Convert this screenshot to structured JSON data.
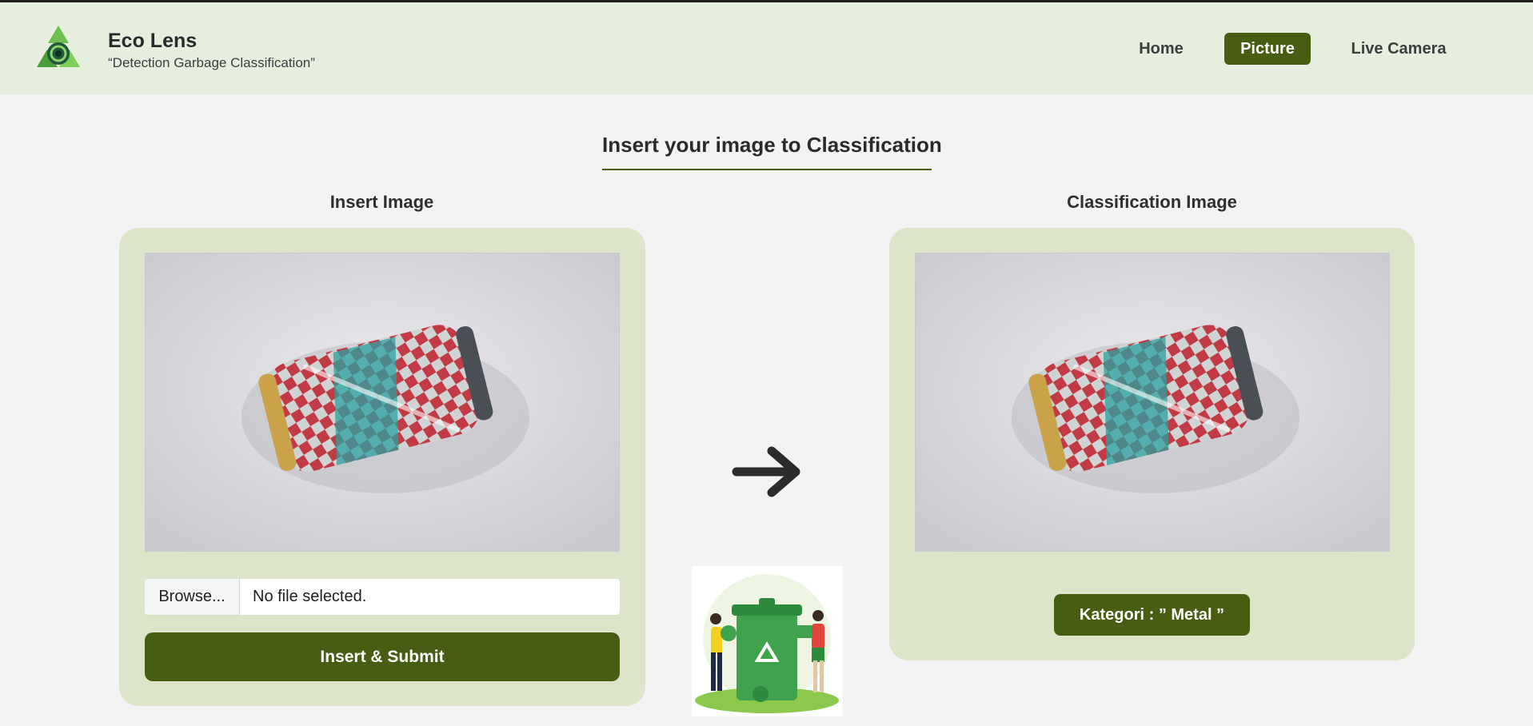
{
  "header": {
    "logo_icon": "recycle-logo-icon",
    "title": "Eco Lens",
    "subtitle": "“Detection Garbage Classification”",
    "nav": {
      "home": "Home",
      "picture": "Picture",
      "live_camera": "Live Camera"
    },
    "accent_color": "#475e12"
  },
  "main": {
    "section_title": "Insert your image to Classification",
    "insert": {
      "title": "Insert Image",
      "browse_label": "Browse...",
      "file_status": "No file selected.",
      "submit_label": "Insert & Submit"
    },
    "arrow_icon": "arrow-right-icon",
    "illustration": "recycling-bin-illustration",
    "classification": {
      "title": "Classification Image",
      "result": "Kategori : ” Metal ”"
    }
  }
}
